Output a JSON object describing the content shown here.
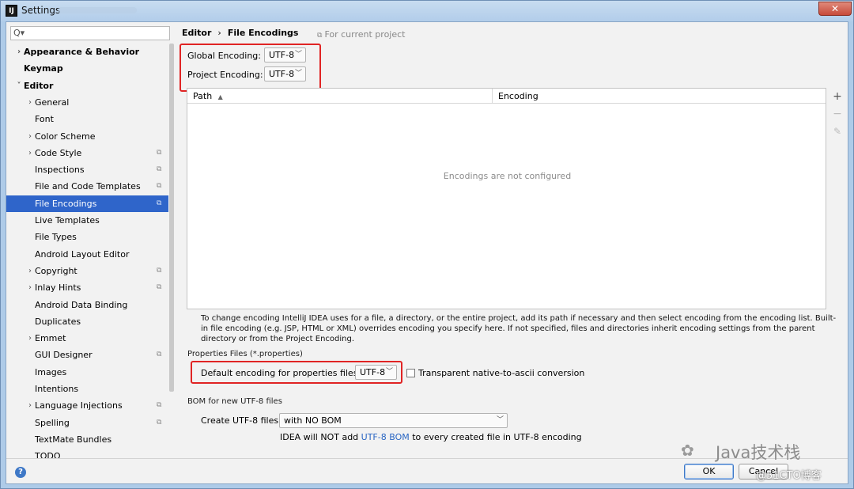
{
  "window": {
    "title": "Settings",
    "app_icon": "IJ",
    "close_glyph": "✕"
  },
  "search": {
    "icon": "search-icon",
    "glyph": "Q▾"
  },
  "sidebar": {
    "items": [
      {
        "label": "Appearance & Behavior",
        "arrow": "›",
        "bold": true
      },
      {
        "label": "Keymap",
        "bold": true
      },
      {
        "label": "Editor",
        "arrow": "˅",
        "bold": true
      },
      {
        "label": "General",
        "arrow": "›"
      },
      {
        "label": "Font"
      },
      {
        "label": "Color Scheme",
        "arrow": "›"
      },
      {
        "label": "Code Style",
        "arrow": "›",
        "project": true
      },
      {
        "label": "Inspections",
        "project": true
      },
      {
        "label": "File and Code Templates",
        "project": true
      },
      {
        "label": "File Encodings",
        "project": true,
        "selected": true
      },
      {
        "label": "Live Templates"
      },
      {
        "label": "File Types"
      },
      {
        "label": "Android Layout Editor"
      },
      {
        "label": "Copyright",
        "arrow": "›",
        "project": true
      },
      {
        "label": "Inlay Hints",
        "arrow": "›",
        "project": true
      },
      {
        "label": "Android Data Binding"
      },
      {
        "label": "Duplicates"
      },
      {
        "label": "Emmet",
        "arrow": "›"
      },
      {
        "label": "GUI Designer",
        "project": true
      },
      {
        "label": "Images"
      },
      {
        "label": "Intentions"
      },
      {
        "label": "Language Injections",
        "arrow": "›",
        "project": true
      },
      {
        "label": "Spelling",
        "project": true
      },
      {
        "label": "TextMate Bundles"
      },
      {
        "label": "TODO"
      }
    ]
  },
  "header": {
    "crumb_parent": "Editor",
    "crumb_sep": "›",
    "crumb_current": "File Encodings",
    "for_project": "For current project"
  },
  "encodings": {
    "global_label": "Global Encoding:",
    "global_value": "UTF-8",
    "project_label": "Project Encoding:",
    "project_value": "UTF-8"
  },
  "table": {
    "col_path": "Path",
    "sort_glyph": "▲",
    "col_encoding": "Encoding",
    "empty_text": "Encodings are not configured",
    "tool_add": "+",
    "tool_remove": "−",
    "tool_edit": "✎"
  },
  "description": "To change encoding IntelliJ IDEA uses for a file, a directory, or the entire project, add its path if necessary and then select encoding from the encoding list. Built-in file encoding (e.g. JSP, HTML or XML) overrides encoding you specify here. If not specified, files and directories inherit encoding settings from the parent directory or from the Project Encoding.",
  "properties": {
    "section_title": "Properties Files (*.properties)",
    "default_label": "Default encoding for properties files:",
    "default_value": "UTF-8",
    "transparent_label": "Transparent native-to-ascii conversion"
  },
  "bom": {
    "section_title": "BOM for new UTF-8 files",
    "create_label": "Create UTF-8 files:",
    "create_value": "with NO BOM",
    "note_prefix": "IDEA will NOT add ",
    "note_link": "UTF-8 BOM",
    "note_suffix": " to every created file in UTF-8 encoding"
  },
  "footer": {
    "help": "?",
    "ok": "OK",
    "cancel": "Cancel"
  },
  "watermark": {
    "logo": "✿",
    "text": "Java技术栈",
    "site": "@51CTO博客"
  },
  "colors": {
    "selection": "#2f65ca",
    "highlight_box": "#e02424",
    "link": "#2a66c3"
  }
}
